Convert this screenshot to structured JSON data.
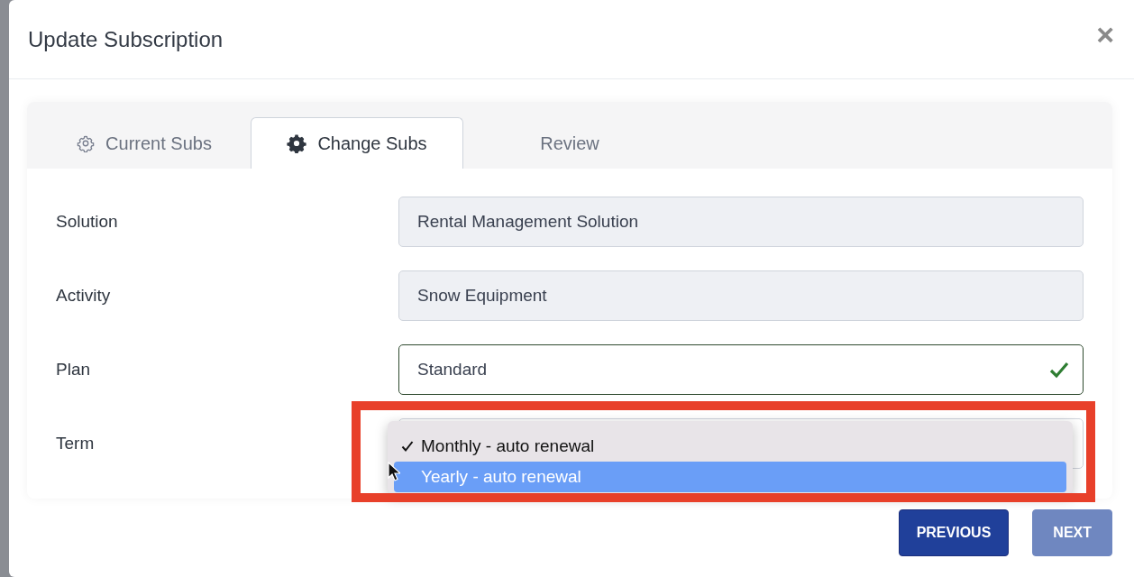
{
  "dialog": {
    "title": "Update Subscription",
    "close": "×"
  },
  "tabs": [
    {
      "label": "Current Subs",
      "kind": "outline",
      "selected": false
    },
    {
      "label": "Change Subs",
      "kind": "solid",
      "selected": true
    },
    {
      "label": "Review",
      "kind": "plain",
      "selected": false
    }
  ],
  "fields": [
    {
      "label": "Solution",
      "value": "Rental Management Solution",
      "disabled": true,
      "valid": false
    },
    {
      "label": "Activity",
      "value": "Snow Equipment",
      "disabled": true,
      "valid": false
    },
    {
      "label": "Plan",
      "value": "Standard",
      "disabled": false,
      "valid": true
    },
    {
      "label": "Term",
      "disabled": false,
      "valid": false,
      "open": true
    }
  ],
  "dropdown": {
    "options": [
      {
        "label": "Monthly - auto renewal",
        "checked": true,
        "selected": false
      },
      {
        "label": "Yearly - auto renewal",
        "checked": false,
        "selected": true
      }
    ]
  },
  "highlight_annotation": true,
  "buttons": [
    {
      "label": "PREVIOUS",
      "disabled": false
    },
    {
      "label": "NEXT",
      "disabled": true
    }
  ]
}
